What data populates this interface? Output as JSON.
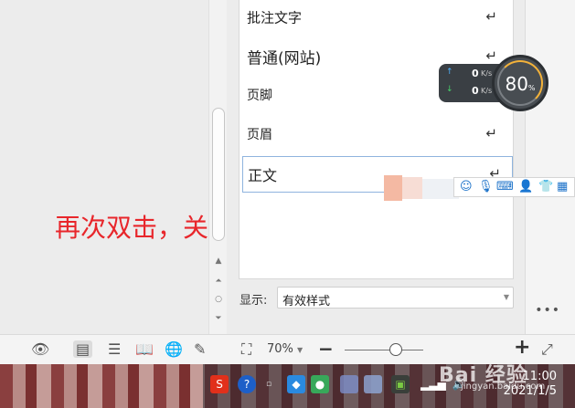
{
  "annotation": "再次双击，关闭全屏显示",
  "styles_panel": {
    "items": [
      {
        "label": "批注文字",
        "size": 15
      },
      {
        "label": "普通(网站)",
        "size": 17
      },
      {
        "label": "页脚",
        "size": 14
      },
      {
        "label": "页眉",
        "size": 14
      },
      {
        "label": "正文",
        "size": 16
      }
    ],
    "return_glyph": "↵",
    "show_label": "显示:",
    "show_value": "有效样式",
    "more": "•••"
  },
  "speed_widget": {
    "up_value": "0",
    "up_unit": "K/s",
    "down_value": "0",
    "down_unit": "K/s",
    "percent": "80",
    "percent_unit": "%"
  },
  "status_bar": {
    "zoom": "70%",
    "zoom_level_percent": 70
  },
  "taskbar": {
    "time": "11:00",
    "date": "2021/1/5"
  },
  "watermark": {
    "text": "Bai 经验",
    "sub": "jingyan.baidu.com"
  },
  "colors": {
    "annotation": "#e8262b",
    "ime_accent": "#1c72c9",
    "gauge_ring": "#f3b23a"
  }
}
